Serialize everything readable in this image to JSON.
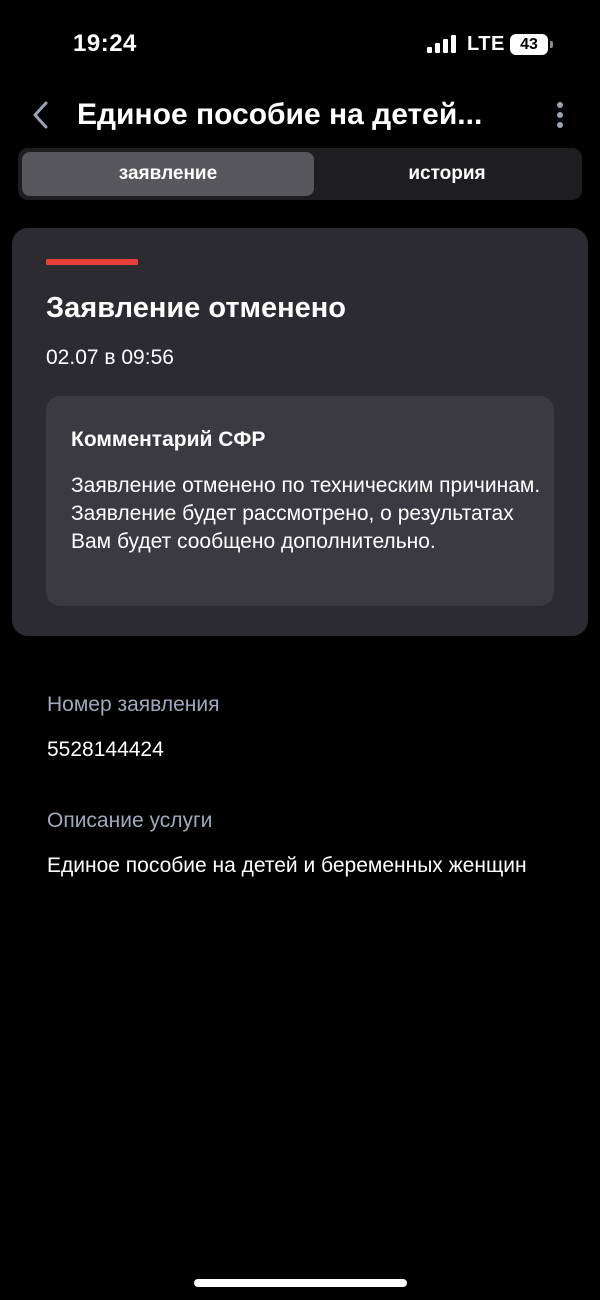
{
  "status_bar": {
    "time": "19:24",
    "network": "LTE",
    "battery": "43",
    "battery_level": 0.43,
    "icons": [
      "signal-icon",
      "battery-icon"
    ]
  },
  "header": {
    "title": "Единое пособие на детей...",
    "icons": [
      "chevron-left-icon",
      "more-vertical-icon"
    ]
  },
  "tabs": [
    {
      "label": "заявление",
      "active": true
    },
    {
      "label": "история",
      "active": false
    }
  ],
  "status_card": {
    "title": "Заявление отменено",
    "date": "02.07 в 09:56",
    "accent_color": "#e8413c",
    "comment": {
      "title": "Комментарий СФР",
      "text": "Заявление отменено по техническим причинам. Заявление будет рассмотрено, о результатах Вам будет сообщено дополнительно."
    }
  },
  "details": {
    "number_label": "Номер заявления",
    "number_value": "5528144424",
    "description_label": "Описание услуги",
    "description_value": "Единое пособие на детей и беременных женщин"
  },
  "colors": {
    "background": "#000000",
    "card": "#2b2b31",
    "comment_box": "#3a3a40",
    "label": "#a0a9bc",
    "accent": "#e8413c"
  }
}
